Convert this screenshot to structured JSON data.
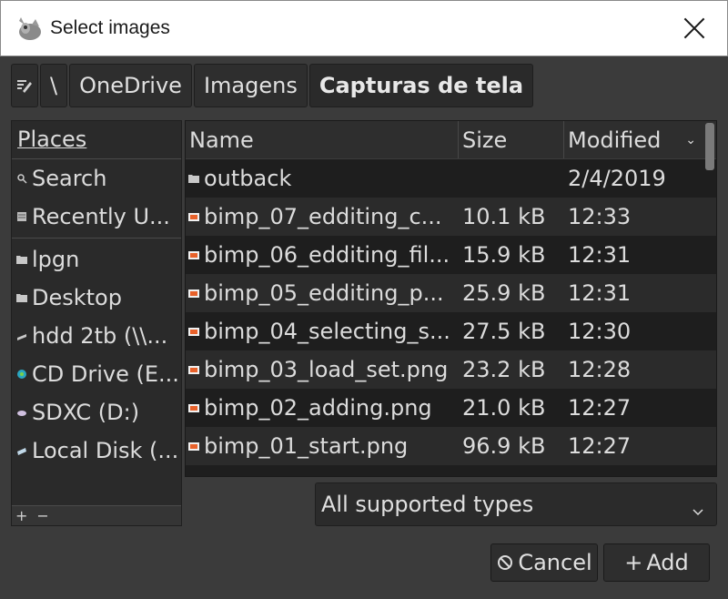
{
  "window": {
    "title": "Select images"
  },
  "pathbar": {
    "separator": "\\",
    "crumbs": [
      "OneDrive",
      "Imagens",
      "Capturas de tela"
    ]
  },
  "places": {
    "header": "Places",
    "items": [
      {
        "label": "Search",
        "icon": "search-icon"
      },
      {
        "label": "Recently U...",
        "icon": "recent-icon"
      },
      {
        "label": "lpgn",
        "icon": "folder-icon"
      },
      {
        "label": "Desktop",
        "icon": "folder-icon"
      },
      {
        "label": "hdd 2tb (\\\\...",
        "icon": "network-drive-icon"
      },
      {
        "label": "CD Drive (E...",
        "icon": "cd-drive-icon"
      },
      {
        "label": "SDXC (D:)",
        "icon": "sd-card-icon"
      },
      {
        "label": "Local Disk (...",
        "icon": "hard-disk-icon"
      }
    ],
    "footer": {
      "add": "+",
      "remove": "−"
    }
  },
  "files": {
    "columns": {
      "name": "Name",
      "size": "Size",
      "modified": "Modified"
    },
    "rows": [
      {
        "name": "outback",
        "size": "",
        "modified": "2/4/2019",
        "icon": "folder-icon"
      },
      {
        "name": "bimp_07_edditing_c...",
        "size": "10.1 kB",
        "modified": "12:33",
        "icon": "image-file-icon"
      },
      {
        "name": "bimp_06_edditing_fil...",
        "size": "15.9 kB",
        "modified": "12:31",
        "icon": "image-file-icon"
      },
      {
        "name": "bimp_05_edditing_p...",
        "size": "25.9 kB",
        "modified": "12:31",
        "icon": "image-file-icon"
      },
      {
        "name": "bimp_04_selecting_s...",
        "size": "27.5 kB",
        "modified": "12:30",
        "icon": "image-file-icon"
      },
      {
        "name": "bimp_03_load_set.png",
        "size": "23.2 kB",
        "modified": "12:28",
        "icon": "image-file-icon"
      },
      {
        "name": "bimp_02_adding.png",
        "size": "21.0 kB",
        "modified": "12:27",
        "icon": "image-file-icon"
      },
      {
        "name": "bimp_01_start.png",
        "size": "96.9 kB",
        "modified": "12:27",
        "icon": "image-file-icon"
      }
    ]
  },
  "filter": {
    "selected": "All supported types"
  },
  "buttons": {
    "cancel": "Cancel",
    "add": "Add"
  },
  "colors": {
    "background": "#3b3b3b",
    "list": "#1e1e1e",
    "image_icon": "#e8612a"
  }
}
